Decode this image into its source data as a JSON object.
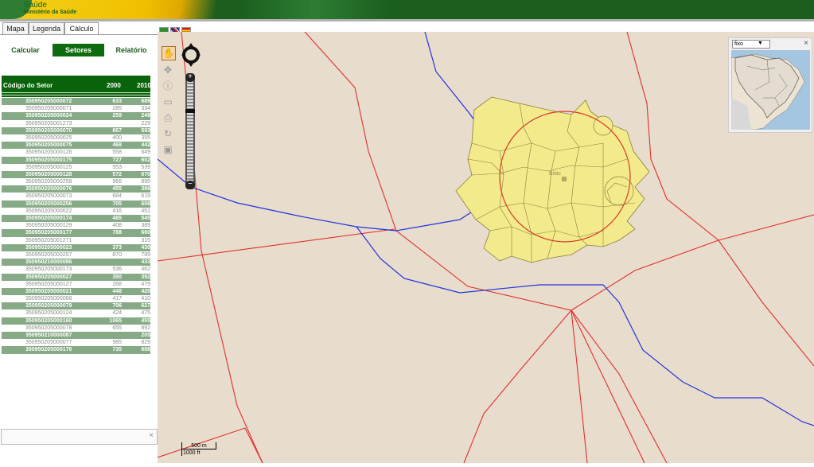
{
  "header": {
    "title": "Saúde",
    "subtitle": "Ministério da Saúde"
  },
  "tabs": [
    {
      "label": "Mapa"
    },
    {
      "label": "Legenda"
    },
    {
      "label": "Cálculo"
    }
  ],
  "actions": {
    "calcular": "Calcular",
    "setores": "Setores",
    "relatorio": "Relatório"
  },
  "table": {
    "columns": [
      "Código do Setor",
      "2000",
      "2010"
    ],
    "rows": [
      {
        "code": "350950205000072",
        "v2000": "633",
        "v2010": "689"
      },
      {
        "code": "350950205000071",
        "v2000": "285",
        "v2010": "334"
      },
      {
        "code": "350950205000024",
        "v2000": "259",
        "v2010": "249"
      },
      {
        "code": "350950205001273",
        "v2000": "",
        "v2010": "229"
      },
      {
        "code": "350950205000070",
        "v2000": "667",
        "v2010": "593"
      },
      {
        "code": "350950205000025",
        "v2000": "400",
        "v2010": "355"
      },
      {
        "code": "350950205000075",
        "v2000": "468",
        "v2010": "442"
      },
      {
        "code": "350950205000126",
        "v2000": "558",
        "v2010": "649"
      },
      {
        "code": "350950205000175",
        "v2000": "727",
        "v2010": "602"
      },
      {
        "code": "350950205000125",
        "v2000": "553",
        "v2010": "539"
      },
      {
        "code": "350950205000128",
        "v2000": "572",
        "v2010": "670"
      },
      {
        "code": "350950205000258",
        "v2000": "966",
        "v2010": "895"
      },
      {
        "code": "350950205000076",
        "v2000": "455",
        "v2010": "386"
      },
      {
        "code": "350950205000073",
        "v2000": "684",
        "v2010": "619"
      },
      {
        "code": "350950205000256",
        "v2000": "705",
        "v2010": "608"
      },
      {
        "code": "350950205000022",
        "v2000": "416",
        "v2010": "451"
      },
      {
        "code": "350950205000174",
        "v2000": "465",
        "v2010": "545"
      },
      {
        "code": "350950205000129",
        "v2000": "408",
        "v2010": "389"
      },
      {
        "code": "350950205000177",
        "v2000": "788",
        "v2010": "660"
      },
      {
        "code": "350950205001271",
        "v2000": "",
        "v2010": "315"
      },
      {
        "code": "350950205000023",
        "v2000": "373",
        "v2010": "430"
      },
      {
        "code": "350950205000257",
        "v2000": "870",
        "v2010": "789"
      },
      {
        "code": "350950210000086",
        "v2000": "",
        "v2010": "433"
      },
      {
        "code": "350950205000173",
        "v2000": "536",
        "v2010": "462"
      },
      {
        "code": "350950205000027",
        "v2000": "350",
        "v2010": "392"
      },
      {
        "code": "350950205000127",
        "v2000": "268",
        "v2010": "479"
      },
      {
        "code": "350950205000021",
        "v2000": "448",
        "v2010": "420"
      },
      {
        "code": "350950205000068",
        "v2000": "417",
        "v2010": "410"
      },
      {
        "code": "350950205000079",
        "v2000": "706",
        "v2010": "627"
      },
      {
        "code": "350950205000124",
        "v2000": "424",
        "v2010": "475"
      },
      {
        "code": "350950205000160",
        "v2000": "1065",
        "v2010": "455"
      },
      {
        "code": "350950205000078",
        "v2000": "655",
        "v2010": "892"
      },
      {
        "code": "350950210000087",
        "v2000": "",
        "v2010": "205"
      },
      {
        "code": "350950205000077",
        "v2000": "985",
        "v2010": "829"
      },
      {
        "code": "350950205000176",
        "v2000": "735",
        "v2010": "688"
      }
    ]
  },
  "map": {
    "city_label": "Bilac",
    "overview_mode": "fixo",
    "scale_top": "500 m",
    "scale_bottom": "1000 ft",
    "colors": {
      "background": "#e8dccd",
      "road": "#e0312a",
      "river": "#2233dd",
      "sector_fill": "#f3ea8c",
      "sector_stroke": "#8a7e3c",
      "buffer_circle": "#d63a2a"
    }
  },
  "bottom_box": {
    "close": "×"
  }
}
